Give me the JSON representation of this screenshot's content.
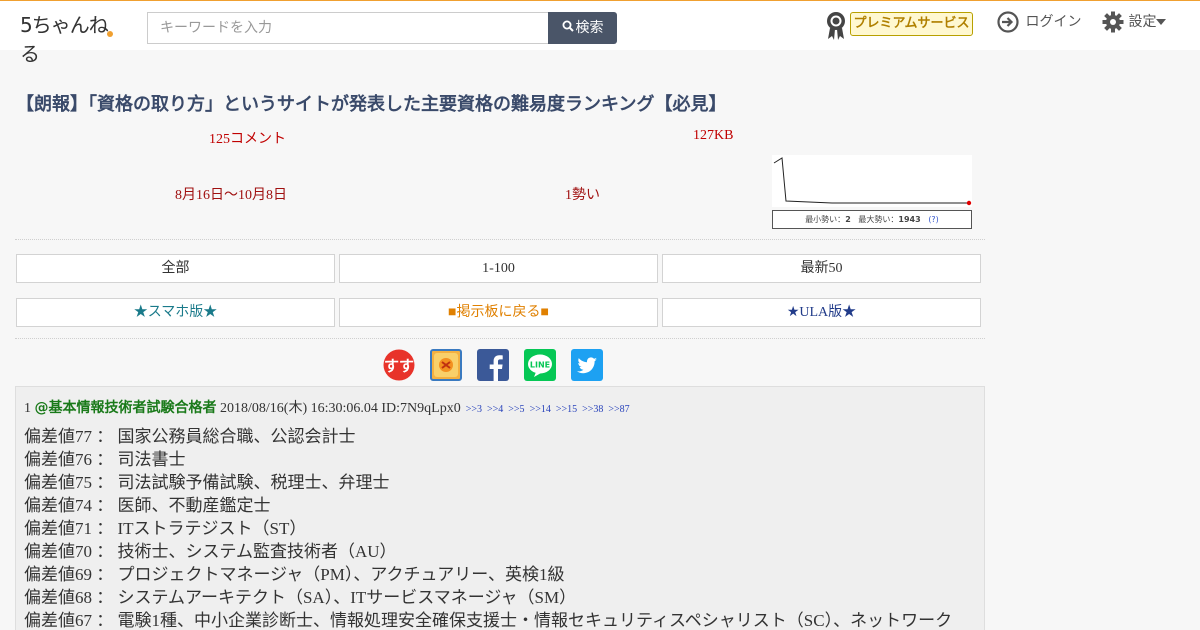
{
  "header": {
    "logo_text": "5ちゃんねる",
    "search_placeholder": "キーワードを入力",
    "search_button": "検索",
    "premium": "プレミアムサービス",
    "login": "ログイン",
    "settings": "設定"
  },
  "thread": {
    "title": "【朗報】「資格の取り方」というサイトが発表した主要資格の難易度ランキング【必見】",
    "comments": "125コメント",
    "size": "127KB",
    "dates": "8月16日〜10月8日",
    "momentum": "1勢い",
    "spark_caption": {
      "min_label": "最小勢い：",
      "min_value": "2",
      "max_label": "最大勢い：",
      "max_value": "1943",
      "help": "(?)"
    }
  },
  "nav": {
    "all": "全部",
    "range": "1-100",
    "latest": "最新50",
    "smartphone": "★スマホ版★",
    "back": "■掲示板に戻る■",
    "ula": "★ULA版★"
  },
  "share": {
    "icons": [
      "sumaho-icon",
      "matome-icon",
      "facebook-icon",
      "line-icon",
      "twitter-icon"
    ],
    "line_text": "LINE",
    "sumaho_text": "すす"
  },
  "post": {
    "number": "1",
    "name": "@基本情報技術者試験合格者",
    "date": "2018/08/16(木) 16:30:06.04",
    "id": "ID:7N9qLpx0",
    "replies": [
      ">>3",
      ">>4",
      ">>5",
      ">>14",
      ">>15",
      ">>38",
      ">>87"
    ],
    "lines": [
      "偏差値77 ： 国家公務員総合職、公認会計士",
      "偏差値76 ： 司法書士",
      "偏差値75 ： 司法試験予備試験、税理士、弁理士",
      "偏差値74 ： 医師、不動産鑑定士",
      "偏差値71 ： ITストラテジスト（ST）",
      "偏差値70 ： 技術士、システム監査技術者（AU）",
      "偏差値69 ： プロジェクトマネージャ（PM）、アクチュアリー、英検1級",
      "偏差値68 ： システムアーキテクト（SA）、ITサービスマネージャ（SM）",
      "偏差値67 ： 電験1種、中小企業診断士、情報処理安全確保支援士・情報セキュリティスペシャリスト（SC）、ネットワーク"
    ]
  },
  "colors": {
    "accent": "#f0a030",
    "title": "#3a4a6a",
    "meta_red": "#c00000",
    "name_green": "#1a7a1a",
    "reply_blue": "#2a44bb"
  }
}
